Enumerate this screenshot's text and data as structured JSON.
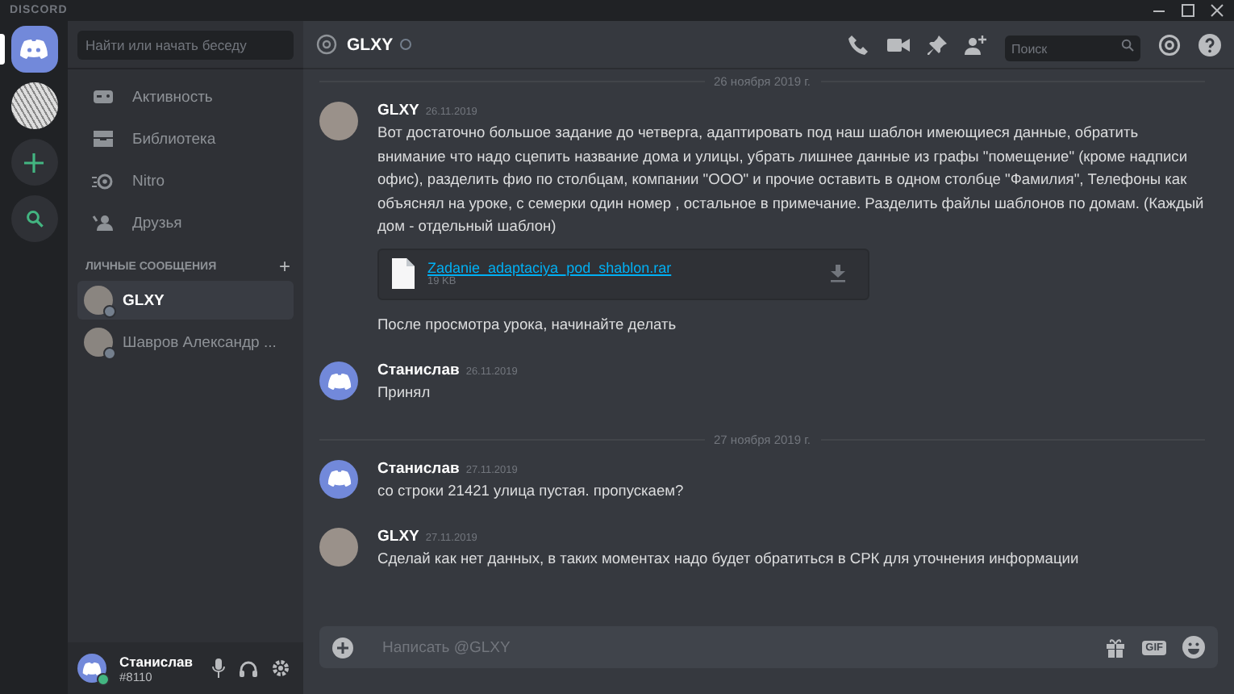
{
  "app_title": "DISCORD",
  "servers": [
    {
      "kind": "home",
      "selected": true
    },
    {
      "kind": "server",
      "selected": false
    },
    {
      "kind": "add",
      "selected": false
    },
    {
      "kind": "search",
      "selected": false
    }
  ],
  "search": {
    "placeholder": "Найти или начать беседу"
  },
  "nav": [
    {
      "kind": "activity",
      "label": "Активность"
    },
    {
      "kind": "library",
      "label": "Библиотека"
    },
    {
      "kind": "nitro",
      "label": "Nitro"
    },
    {
      "kind": "friends",
      "label": "Друзья"
    }
  ],
  "dm_header": {
    "label": "ЛИЧНЫЕ СООБЩЕНИЯ",
    "add": "+"
  },
  "dms": [
    {
      "name": "GLXY",
      "selected": true
    },
    {
      "name": "Шавров Александр ...",
      "selected": false
    }
  ],
  "user": {
    "name": "Станислав",
    "tag": "#8110",
    "online": true
  },
  "channel": {
    "name": "GLXY",
    "search_placeholder": "Поиск"
  },
  "messages": [
    {
      "kind": "divider",
      "text": "26 ноября 2019 г."
    },
    {
      "kind": "message",
      "author": "GLXY",
      "avatar": {
        "kind": "photo"
      },
      "date": "26.11.2019",
      "text": "Вот достаточно большое задание до четверга, адаптировать под наш шаблон имеющиеся данные, обратить внимание что надо сцепить название дома и улицы, убрать лишнее данные из графы \"помещение\" (кроме надписи офис), разделить фио по столбцам, компании \"ООО\" и прочие оставить в одном столбце \"Фамилия\", Телефоны как объяснял на уроке, с семерки один номер , остальное в примечание. Разделить файлы шаблонов по домам. (Каждый дом - отдельный шаблон)",
      "file": {
        "name": "Zadanie_adaptaciya_pod_shablon.rar",
        "size": "19 KB"
      },
      "after": "После просмотра урока, начинайте делать"
    },
    {
      "kind": "message",
      "author": "Станислав",
      "avatar": {
        "kind": "logo"
      },
      "date": "26.11.2019",
      "text": "Принял"
    },
    {
      "kind": "divider",
      "text": "27 ноября 2019 г."
    },
    {
      "kind": "message",
      "author": "Станислав",
      "avatar": {
        "kind": "logo"
      },
      "date": "27.11.2019",
      "text": "со строки 21421 улица пустая. пропускаем?"
    },
    {
      "kind": "message",
      "author": "GLXY",
      "avatar": {
        "kind": "photo"
      },
      "date": "27.11.2019",
      "text": "Сделай как нет данных, в таких моментах надо будет обратиться в СРК для уточнения информации"
    }
  ],
  "composer": {
    "placeholder": "Написать @GLXY",
    "gif": "GIF"
  }
}
